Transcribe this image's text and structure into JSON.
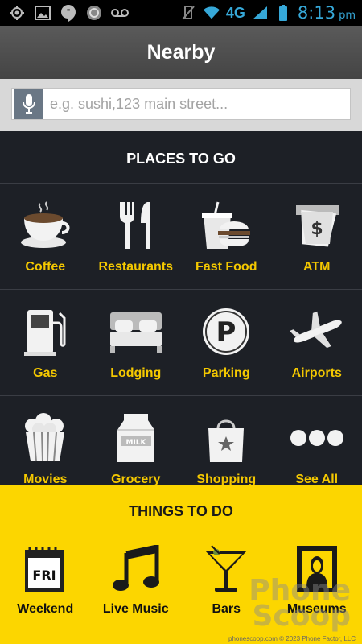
{
  "status_bar": {
    "network": "4G",
    "time": "8:13",
    "ampm": "pm",
    "accent_color": "#36a8d8"
  },
  "header": {
    "title": "Nearby"
  },
  "search": {
    "placeholder": "e.g. sushi,123 main street..."
  },
  "places": {
    "title": "PLACES TO GO",
    "rows": [
      [
        {
          "label": "Coffee",
          "icon": "coffee-icon"
        },
        {
          "label": "Restaurants",
          "icon": "restaurants-icon"
        },
        {
          "label": "Fast Food",
          "icon": "fast-food-icon"
        },
        {
          "label": "ATM",
          "icon": "atm-icon"
        }
      ],
      [
        {
          "label": "Gas",
          "icon": "gas-icon"
        },
        {
          "label": "Lodging",
          "icon": "lodging-icon"
        },
        {
          "label": "Parking",
          "icon": "parking-icon"
        },
        {
          "label": "Airports",
          "icon": "airports-icon"
        }
      ],
      [
        {
          "label": "Movies",
          "icon": "movies-icon"
        },
        {
          "label": "Grocery",
          "icon": "grocery-icon"
        },
        {
          "label": "Shopping",
          "icon": "shopping-icon"
        },
        {
          "label": "See All",
          "icon": "more-icon"
        }
      ]
    ],
    "label_color": "#f4c800"
  },
  "things": {
    "title": "THINGS TO DO",
    "items": [
      {
        "label": "Weekend",
        "icon": "calendar-icon",
        "badge": "FRI"
      },
      {
        "label": "Live Music",
        "icon": "music-note-icon"
      },
      {
        "label": "Bars",
        "icon": "cocktail-icon"
      },
      {
        "label": "Museums",
        "icon": "museum-icon"
      }
    ],
    "background_color": "#fcd600"
  },
  "atm_icon_text": "$",
  "grocery_icon_text": "MILK",
  "parking_icon_text": "P",
  "watermark": {
    "line1": "Phone",
    "line2": "Scoop"
  },
  "credit": "phonescoop.com  © 2023 Phone Factor, LLC"
}
